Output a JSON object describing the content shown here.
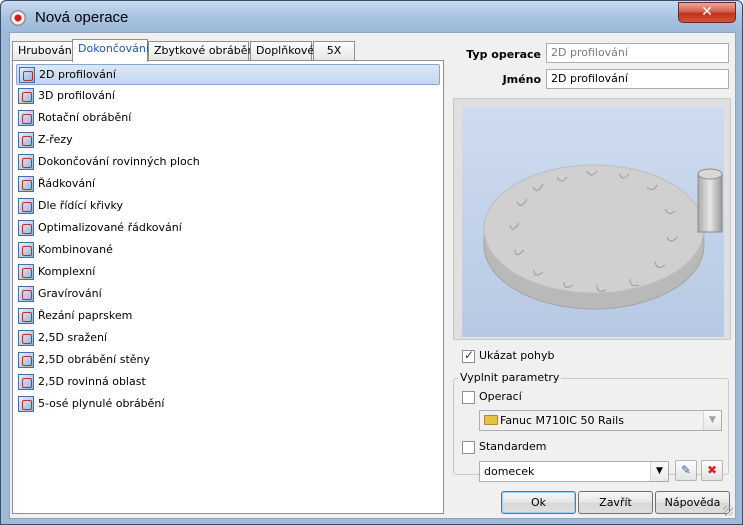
{
  "window": {
    "title": "Nová operace",
    "close_label": "✕"
  },
  "tabs": [
    {
      "label": "Hrubování",
      "active": false
    },
    {
      "label": "Dokončování",
      "active": true
    },
    {
      "label": "Zbytkové obrábění",
      "active": false
    },
    {
      "label": "Doplňkové",
      "active": false
    },
    {
      "label": "5X",
      "active": false
    }
  ],
  "operations": [
    {
      "label": "2D profilování",
      "selected": true,
      "icon": "2d-profiling-icon"
    },
    {
      "label": "3D profilování",
      "selected": false,
      "icon": "3d-profiling-icon"
    },
    {
      "label": "Rotační obrábění",
      "selected": false,
      "icon": "rotary-machining-icon"
    },
    {
      "label": "Z-řezy",
      "selected": false,
      "icon": "z-cuts-icon"
    },
    {
      "label": "Dokončování rovinných ploch",
      "selected": false,
      "icon": "flat-finishing-icon"
    },
    {
      "label": "Řádkování",
      "selected": false,
      "icon": "raster-icon"
    },
    {
      "label": "Dle řídící křivky",
      "selected": false,
      "icon": "guide-curve-icon"
    },
    {
      "label": "Optimalizované řádkování",
      "selected": false,
      "icon": "optimized-raster-icon"
    },
    {
      "label": "Kombinované",
      "selected": false,
      "icon": "combined-icon"
    },
    {
      "label": "Komplexní",
      "selected": false,
      "icon": "complex-icon"
    },
    {
      "label": "Gravírování",
      "selected": false,
      "icon": "engraving-icon"
    },
    {
      "label": "Řezání paprskem",
      "selected": false,
      "icon": "beam-cutting-icon"
    },
    {
      "label": "2,5D sražení",
      "selected": false,
      "icon": "chamfer-icon"
    },
    {
      "label": "2,5D obrábění stěny",
      "selected": false,
      "icon": "wall-machining-icon"
    },
    {
      "label": "2,5D rovinná oblast",
      "selected": false,
      "icon": "planar-area-icon"
    },
    {
      "label": "5-osé plynulé obrábění",
      "selected": false,
      "icon": "5-axis-icon"
    }
  ],
  "details": {
    "type_label": "Typ operace",
    "type_value": "2D profilování",
    "name_label": "Jméno",
    "name_value": "2D profilování"
  },
  "preview": {
    "show_motion_label": "Ukázat pohyb",
    "show_motion_checked": true
  },
  "fill_params": {
    "group_title": "Vyplnit parametry",
    "operation_label": "Operací",
    "operation_checked": false,
    "operation_value": "Fanuc M710IC 50 Rails",
    "default_label": "Standardem",
    "default_checked": false,
    "default_value": "domecek"
  },
  "buttons": {
    "ok": "Ok",
    "close": "Zavřít",
    "help": "Nápověda"
  }
}
